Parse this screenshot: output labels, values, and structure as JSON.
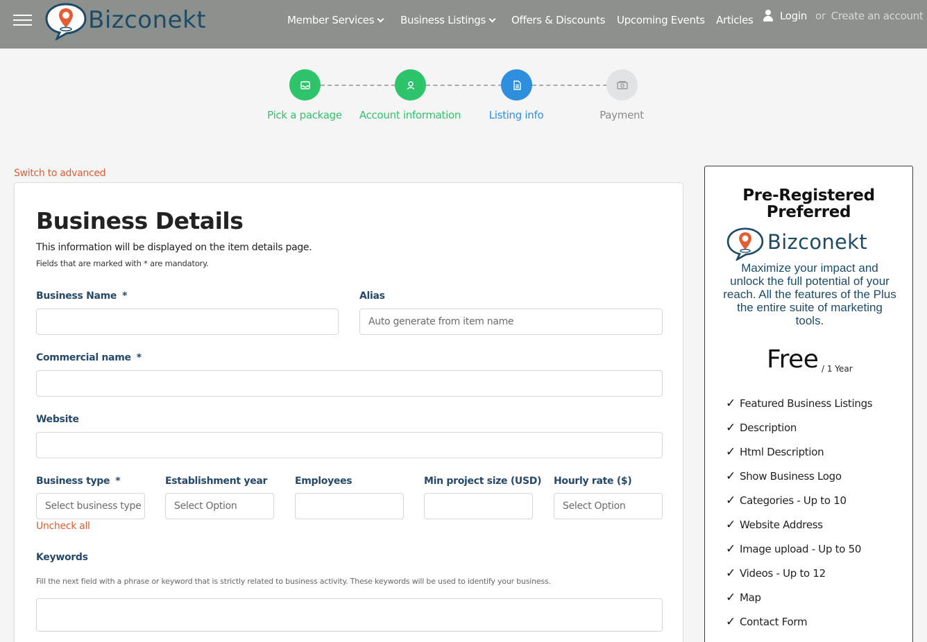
{
  "header": {
    "brand": "Bizconekt",
    "nav": [
      {
        "label": "Member Services",
        "has_dropdown": true
      },
      {
        "label": "Business Listings",
        "has_dropdown": true
      },
      {
        "label": "Offers & Discounts",
        "has_dropdown": false
      },
      {
        "label": "Upcoming Events",
        "has_dropdown": false
      },
      {
        "label": "Articles",
        "has_dropdown": false
      }
    ],
    "login_label": "Login",
    "or_label": "or",
    "create_account_label": "Create an account"
  },
  "stepper": {
    "steps": [
      {
        "label": "Pick a package",
        "state": "complete",
        "icon": "inbox-icon"
      },
      {
        "label": "Account information",
        "state": "complete",
        "icon": "user-icon"
      },
      {
        "label": "Listing info",
        "state": "active",
        "icon": "document-icon"
      },
      {
        "label": "Payment",
        "state": "pending",
        "icon": "money-icon"
      }
    ],
    "colors": {
      "complete": "#2ec46b",
      "active": "#2f8fdf",
      "pending": "#e2e3e4"
    }
  },
  "form": {
    "switch_label": "Switch to advanced",
    "title": "Business Details",
    "subtitle": "This information will be displayed on the item details page.",
    "mandatory_note": "Fields that are marked with * are mandatory.",
    "required_marker": "*",
    "fields": {
      "business_name": {
        "label": "Business Name",
        "value": ""
      },
      "alias": {
        "label": "Alias",
        "placeholder": "Auto generate from item name"
      },
      "commercial_name": {
        "label": "Commercial name",
        "value": ""
      },
      "website": {
        "label": "Website",
        "value": ""
      },
      "business_type": {
        "label": "Business type",
        "placeholder": "Select business type"
      },
      "establishment_year": {
        "label": "Establishment year",
        "placeholder": "Select Option"
      },
      "employees": {
        "label": "Employees",
        "value": ""
      },
      "min_project_size": {
        "label": "Min project size (USD)",
        "value": ""
      },
      "hourly_rate": {
        "label": "Hourly rate ($)",
        "placeholder": "Select Option"
      },
      "keywords": {
        "label": "Keywords",
        "help": "Fill the next field with a phrase or keyword that is strictly related to business activity. These keywords will be used to identify your business.",
        "value": ""
      }
    },
    "uncheck_all_label": "Uncheck all"
  },
  "package": {
    "title_line1": "Pre-Registered",
    "title_line2": "Preferred",
    "brand": "Bizconekt",
    "description": "Maximize your impact and unlock the full potential of your reach. All the features of the Plus the entire suite of marketing tools.",
    "price": "Free",
    "period": "/ 1 Year",
    "check_mark": "✓",
    "features": [
      "Featured Business Listings",
      "Description",
      "Html Description",
      "Show Business Logo",
      "Categories - Up to 10",
      "Website Address",
      "Image upload - Up to 50",
      "Videos - Up to 12",
      "Map",
      "Contact Form"
    ]
  }
}
